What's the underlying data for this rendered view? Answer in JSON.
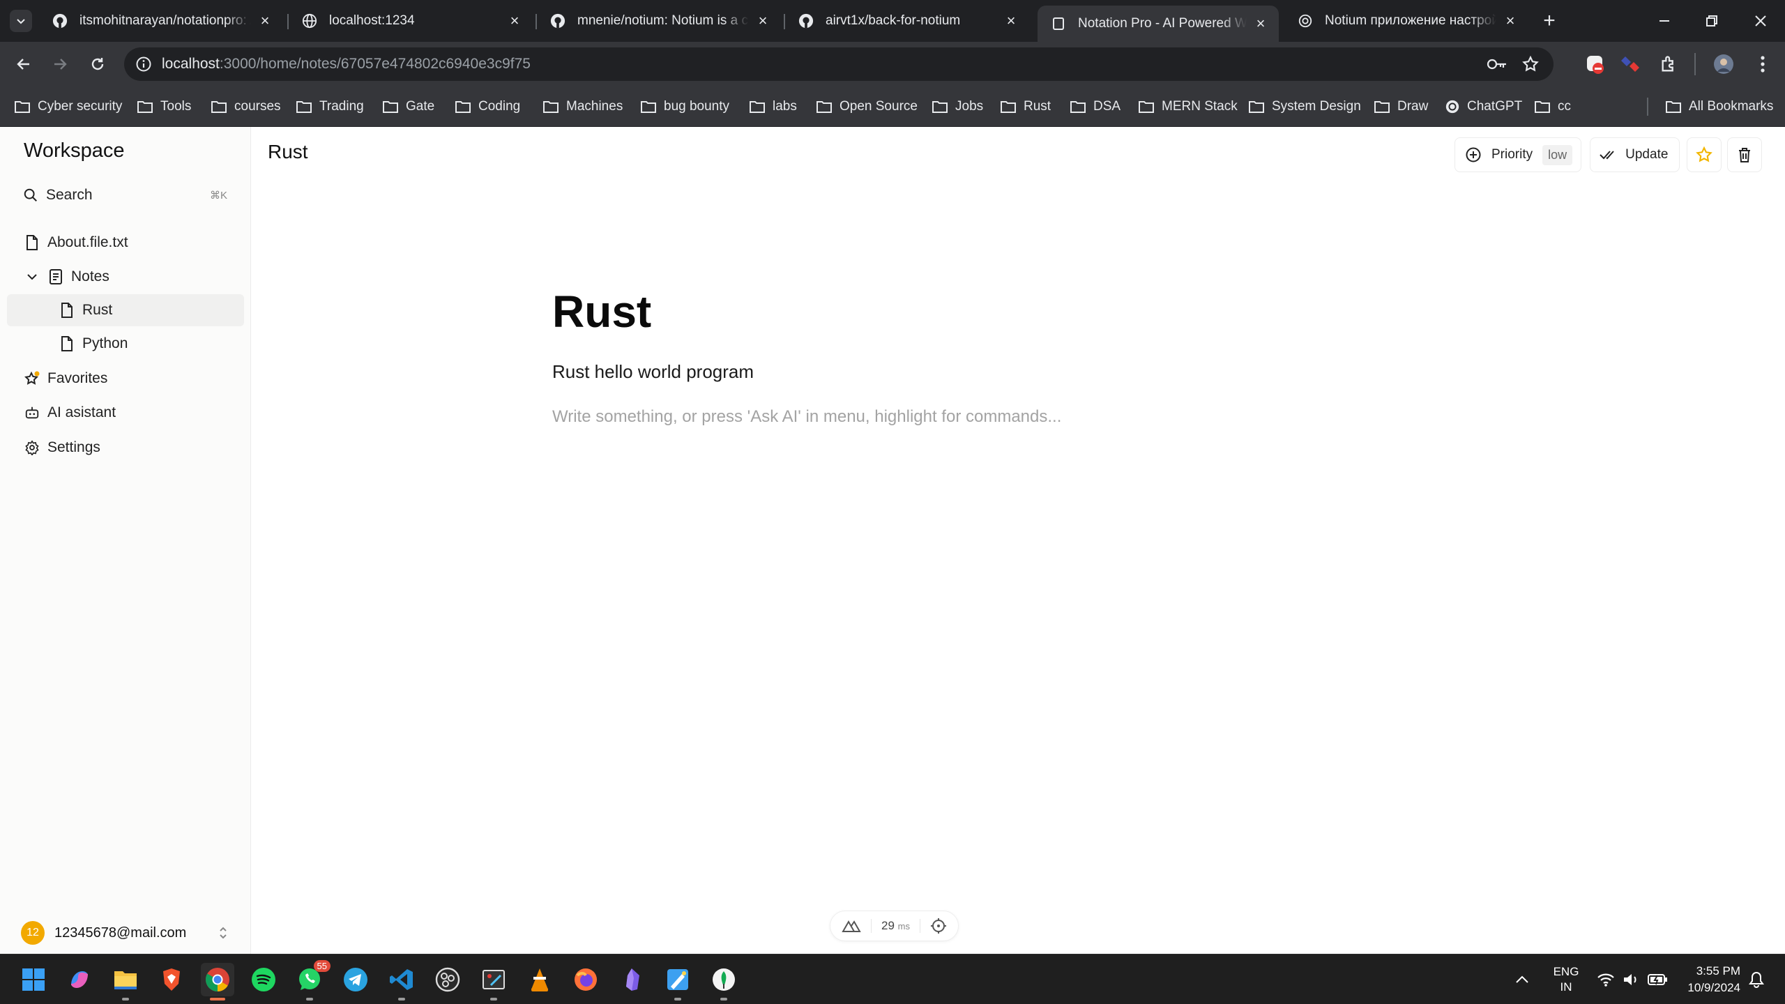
{
  "browser": {
    "tabs": [
      {
        "title": "itsmohitnarayan/notationpro: A",
        "icon": "github-icon",
        "active": false
      },
      {
        "title": "localhost:1234",
        "icon": "globe-icon",
        "active": false
      },
      {
        "title": "mnenie/notium: Notium is a clo",
        "icon": "github-icon",
        "active": false
      },
      {
        "title": "airvt1x/back-for-notium",
        "icon": "github-icon",
        "active": false
      },
      {
        "title": "Notation Pro - AI Powered Web",
        "icon": "page-icon",
        "active": true
      },
      {
        "title": "Notium приложение настройк",
        "icon": "openai-icon",
        "active": false
      }
    ],
    "url_host": "localhost",
    "url_path": ":3000/home/notes/67057e474802c6940e3c9f75",
    "bookmarks": [
      "Cyber security",
      "Tools",
      "courses",
      "Trading",
      "Gate",
      "Coding",
      "Machines",
      "bug bounty",
      "labs",
      "Open Source",
      "Jobs",
      "Rust",
      "DSA",
      "MERN Stack",
      "System Design",
      "Draw",
      "ChatGPT",
      "cc"
    ],
    "all_bookmarks": "All Bookmarks"
  },
  "sidebar": {
    "workspace_title": "Workspace",
    "search_label": "Search",
    "search_shortcut": "⌘K",
    "about_file": "About.file.txt",
    "notes_label": "Notes",
    "notes": [
      {
        "label": "Rust",
        "selected": true
      },
      {
        "label": "Python",
        "selected": false
      }
    ],
    "favorites_label": "Favorites",
    "ai_label": "AI asistant",
    "settings_label": "Settings",
    "user_initials": "12",
    "user_email": "12345678@mail.com"
  },
  "header": {
    "title": "Rust",
    "priority_label": "Priority",
    "priority_value": "low",
    "update_label": "Update"
  },
  "document": {
    "title": "Rust",
    "body": "Rust hello world program",
    "placeholder": "Write something, or press 'Ask AI' in menu, highlight for commands..."
  },
  "devbar": {
    "ms_value": "29",
    "ms_unit": "ms"
  },
  "taskbar": {
    "whatsapp_badge": "55",
    "lang_line1": "ENG",
    "lang_line2": "IN",
    "time": "3:55 PM",
    "date": "10/9/2024"
  },
  "colors": {
    "chrome_dark": "#202124",
    "chrome_toolbar": "#35363a",
    "sidebar_bg": "#fbfbfa",
    "avatar": "#f2a900",
    "favorite_star": "#f2b600"
  }
}
